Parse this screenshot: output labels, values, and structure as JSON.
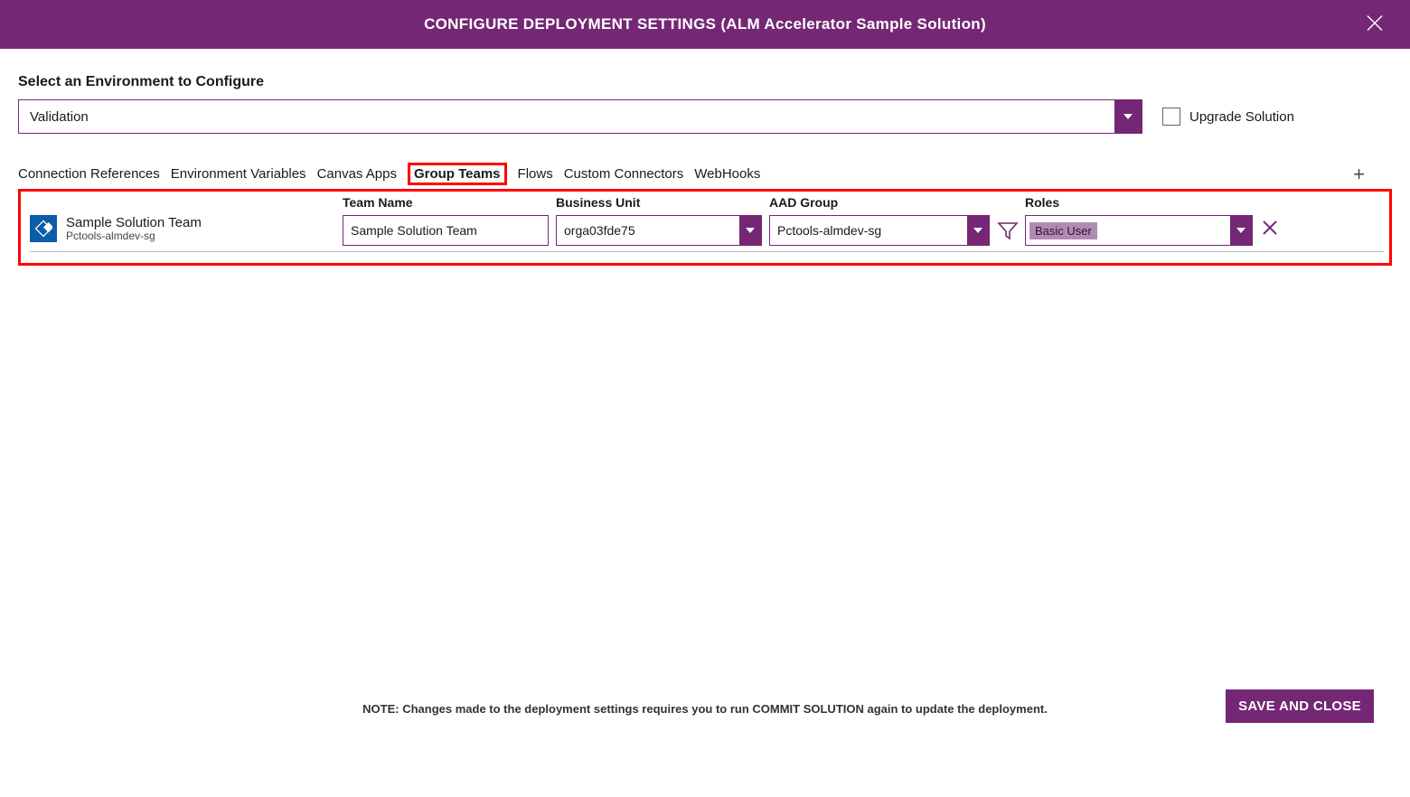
{
  "header": {
    "title": "CONFIGURE DEPLOYMENT SETTINGS (ALM Accelerator Sample Solution)"
  },
  "env": {
    "label": "Select an Environment to Configure",
    "selected": "Validation",
    "upgrade_label": "Upgrade Solution"
  },
  "tabs": [
    {
      "label": "Connection References"
    },
    {
      "label": "Environment Variables"
    },
    {
      "label": "Canvas Apps"
    },
    {
      "label": "Group Teams",
      "highlighted": true
    },
    {
      "label": "Flows"
    },
    {
      "label": "Custom Connectors"
    },
    {
      "label": "WebHooks"
    }
  ],
  "grid": {
    "headers": {
      "team_name": "Team Name",
      "business_unit": "Business Unit",
      "aad_group": "AAD Group",
      "roles": "Roles"
    },
    "row": {
      "display_title": "Sample Solution Team",
      "display_sub": "Pctools-almdev-sg",
      "team_name": "Sample Solution Team",
      "business_unit": "orga03fde75",
      "aad_group": "Pctools-almdev-sg",
      "roles": "Basic User"
    }
  },
  "footer": {
    "note": "NOTE: Changes made to the deployment settings requires you to run COMMIT SOLUTION again to update the deployment.",
    "save_label": "SAVE AND CLOSE"
  }
}
